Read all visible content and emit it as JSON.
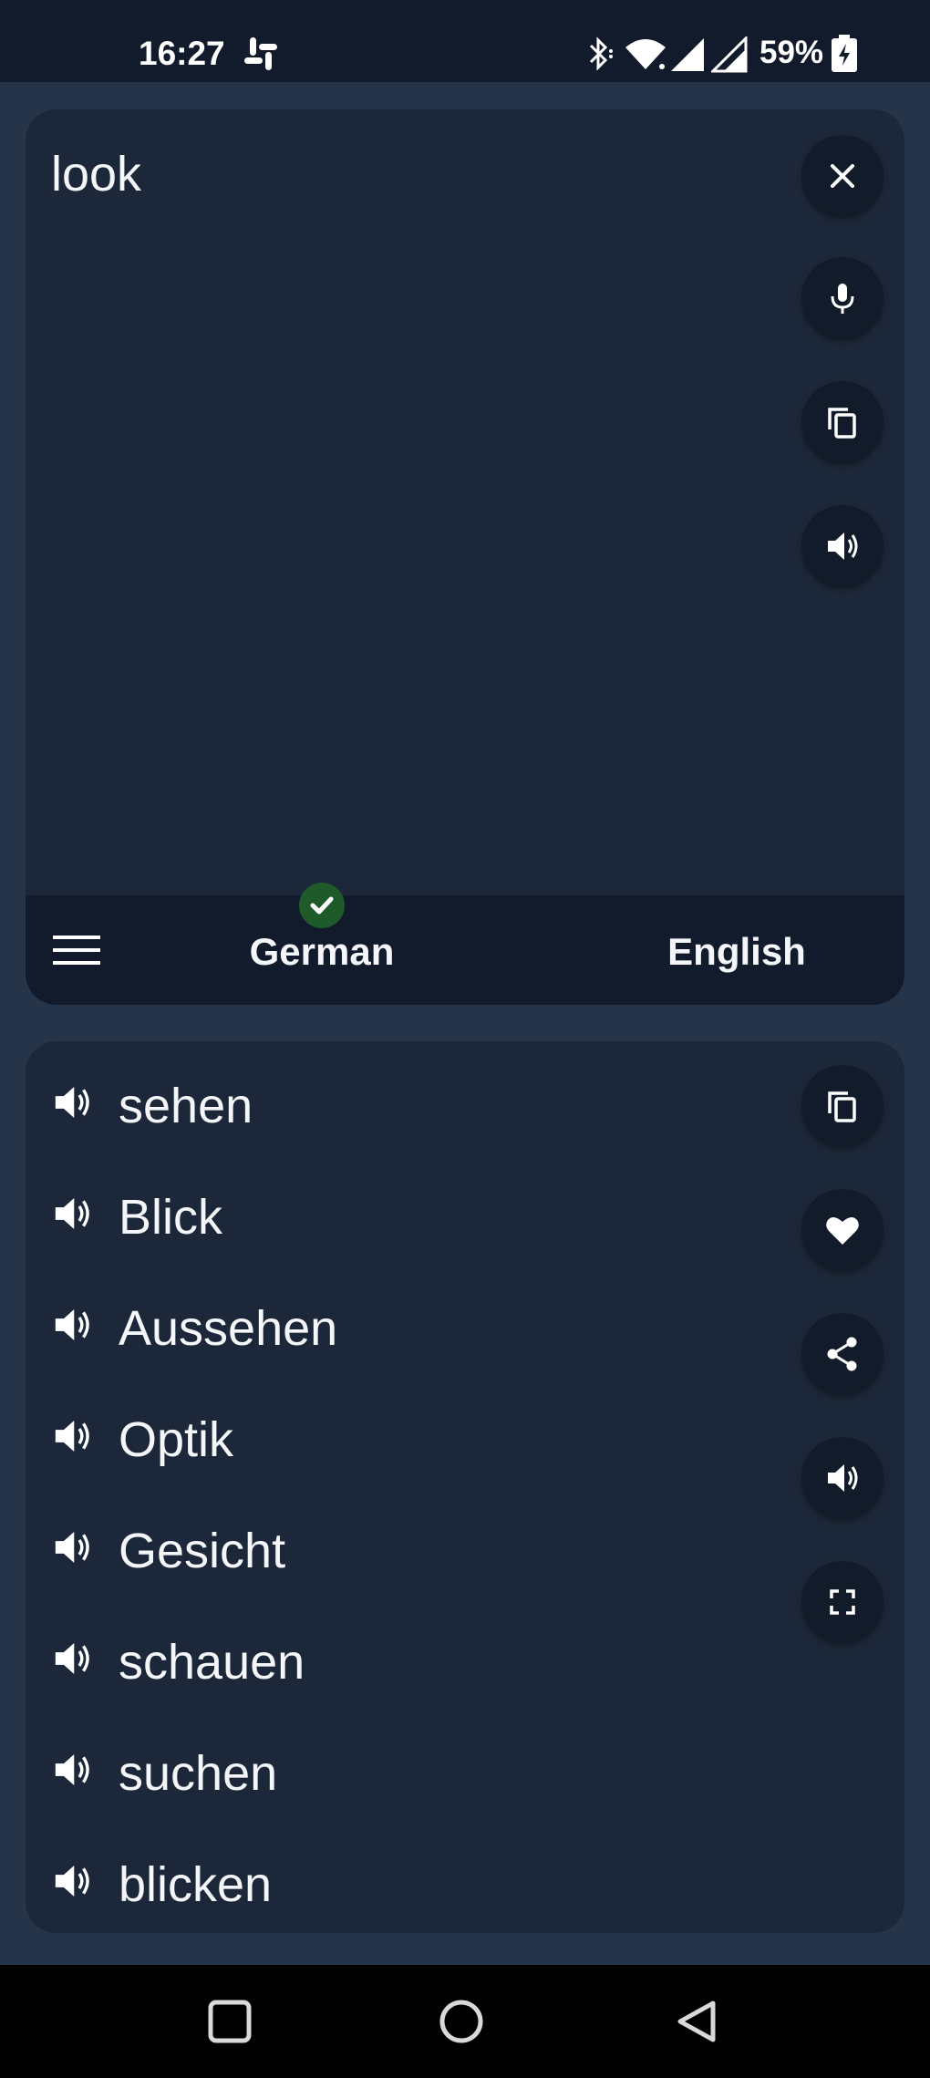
{
  "status_bar": {
    "time": "16:27",
    "battery_percent": "59%",
    "icons": [
      "slack-icon",
      "bluetooth-icon",
      "wifi-icon",
      "signal-icon",
      "signal-icon",
      "battery-charging-icon"
    ]
  },
  "input": {
    "text": "look",
    "buttons": [
      "close-icon",
      "microphone-icon",
      "copy-icon",
      "speaker-icon"
    ]
  },
  "languages": {
    "source": "German",
    "target": "English",
    "source_detected": true
  },
  "results": {
    "items": [
      "sehen",
      "Blick",
      "Aussehen",
      "Optik",
      "Gesicht",
      "schauen",
      "suchen",
      "blicken"
    ],
    "buttons": [
      "copy-icon",
      "heart-icon",
      "share-icon",
      "speaker-icon",
      "fullscreen-icon"
    ]
  },
  "colors": {
    "background": "#26344a",
    "card": "#1c2839",
    "bar": "#111b2b",
    "check_badge": "#1f5a2a"
  }
}
